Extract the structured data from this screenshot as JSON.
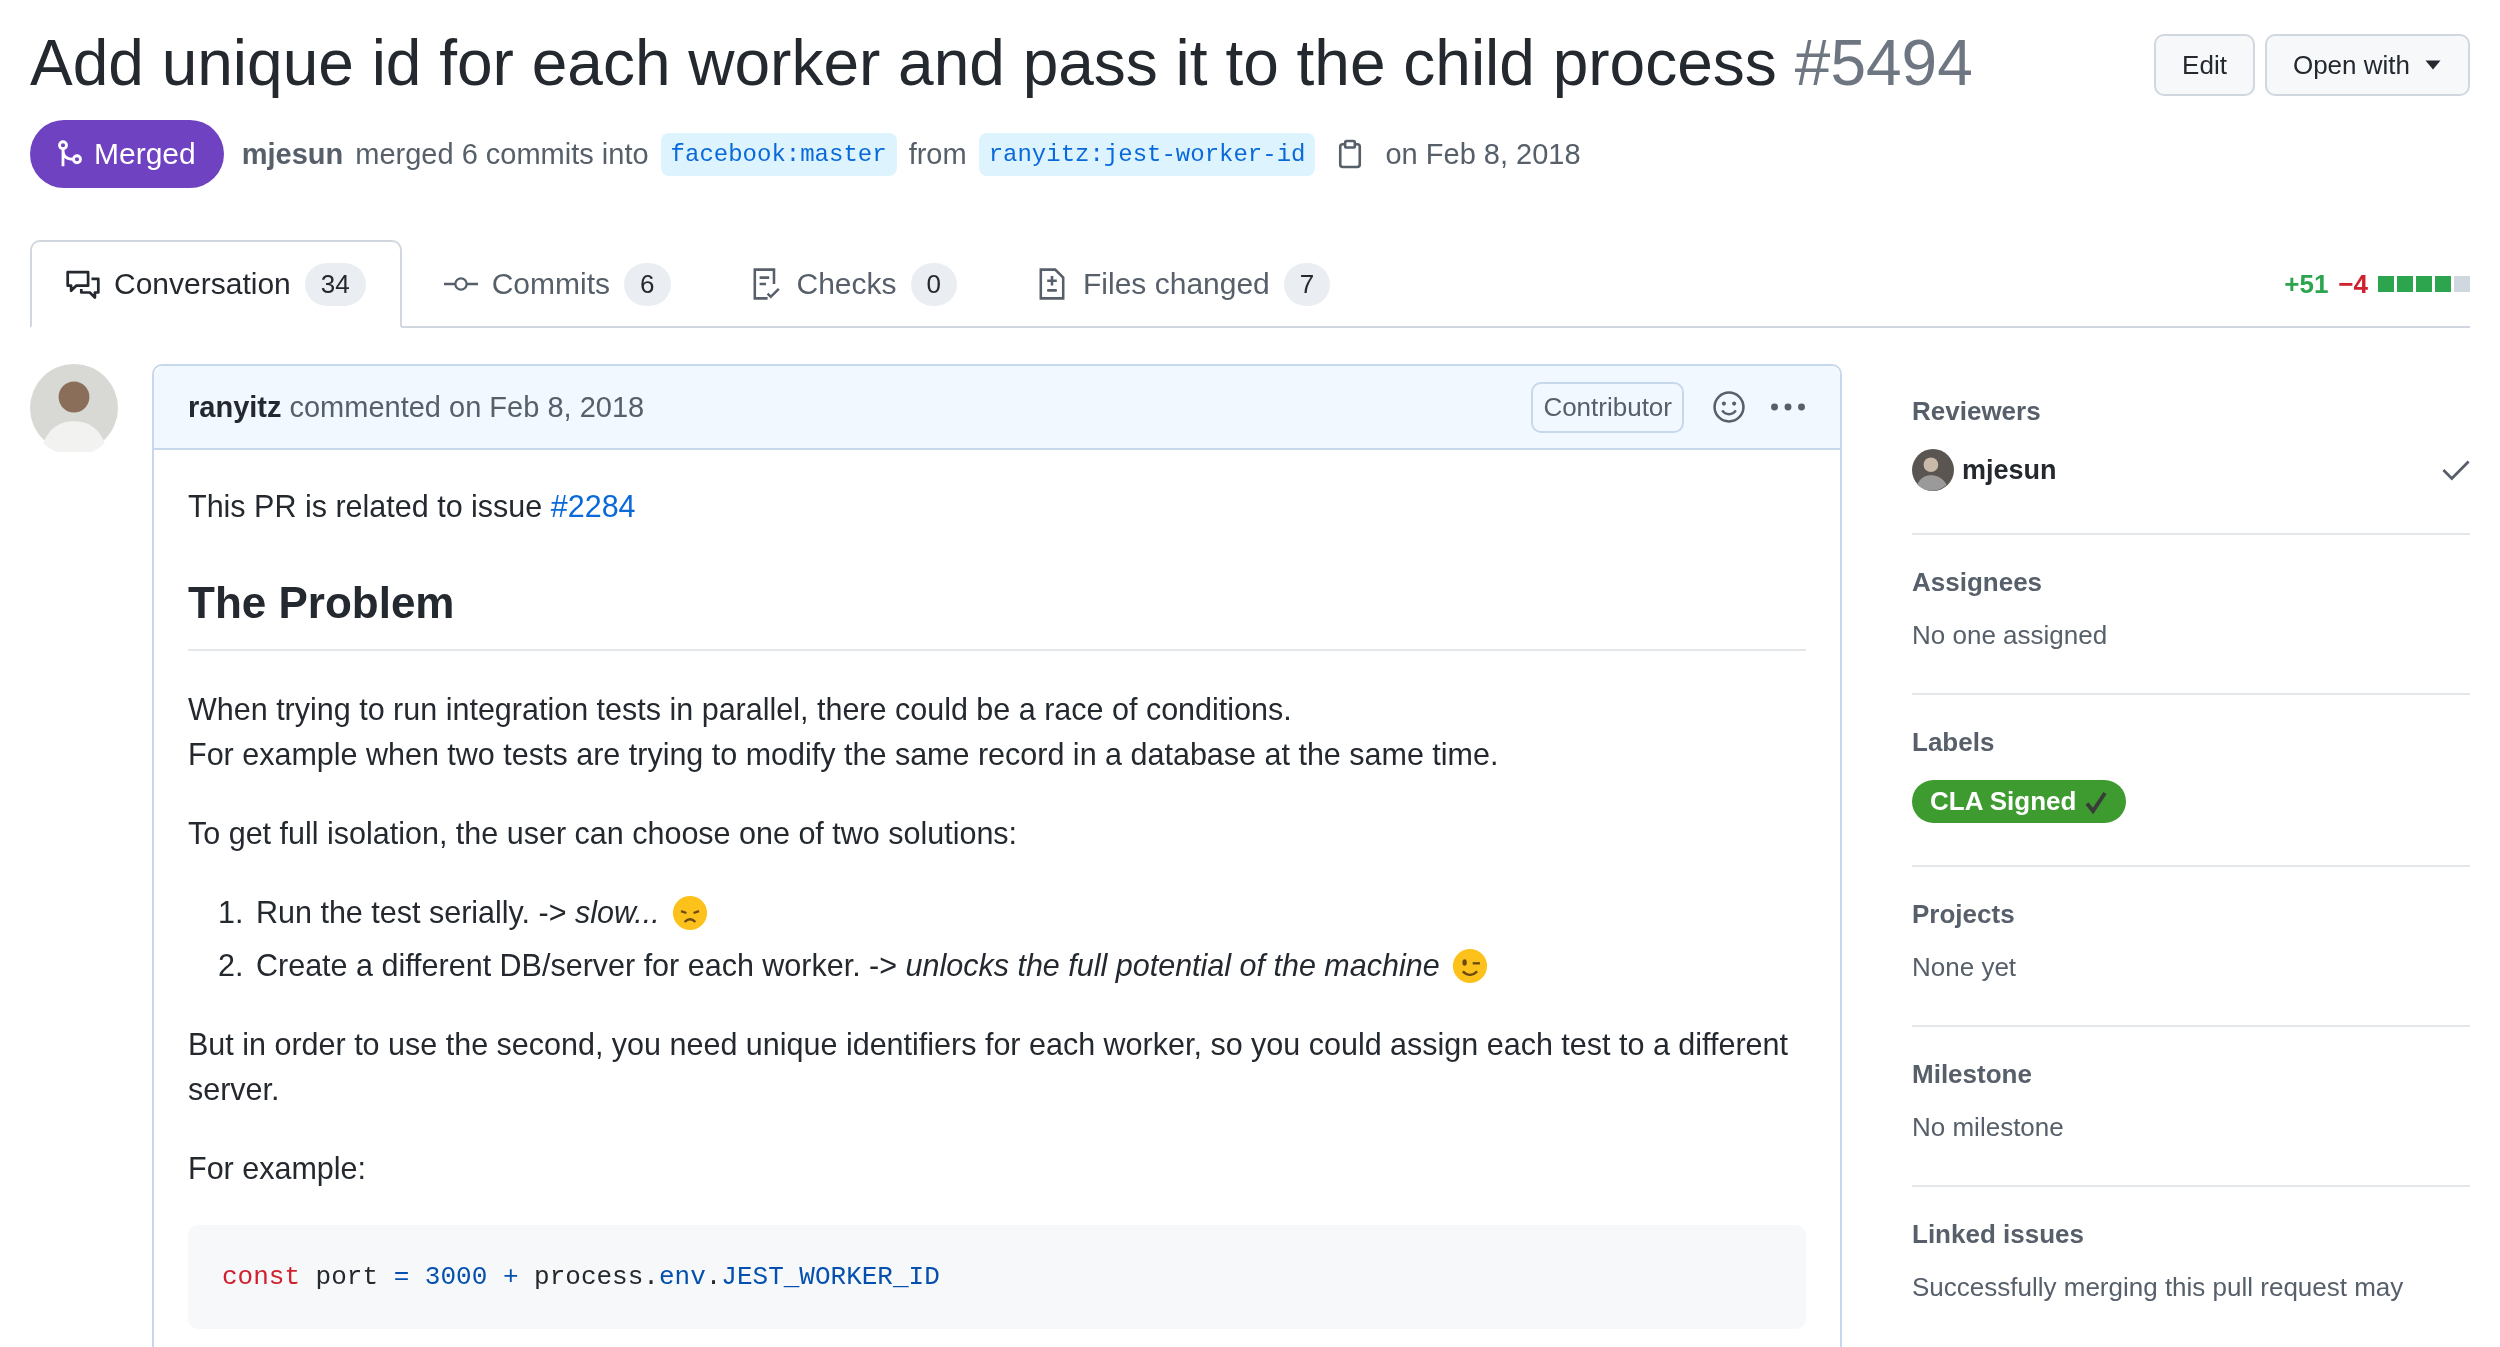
{
  "title": "Add unique id for each worker and pass it to the child process",
  "number": "#5494",
  "header_buttons": [
    {
      "label": "Edit",
      "dropdown": false
    },
    {
      "label": "Open with",
      "dropdown": true
    }
  ],
  "state": {
    "label": "Merged",
    "author": "mjesun",
    "action": "merged 6 commits into",
    "base": "facebook:master",
    "from_word": "from",
    "head": "ranyitz:jest-worker-id",
    "date": "on Feb 8, 2018"
  },
  "tabs": [
    {
      "label": "Conversation",
      "count": "34",
      "selected": true
    },
    {
      "label": "Commits",
      "count": "6",
      "selected": false
    },
    {
      "label": "Checks",
      "count": "0",
      "selected": false
    },
    {
      "label": "Files changed",
      "count": "7",
      "selected": false
    }
  ],
  "diffstat": {
    "added": "+51",
    "removed": "−4",
    "blocks": [
      {
        "filled": true
      },
      {
        "filled": true
      },
      {
        "filled": true
      },
      {
        "filled": true
      },
      {
        "filled": false
      }
    ]
  },
  "comment": {
    "author": "ranyitz",
    "meta": "commented on Feb 8, 2018",
    "role": "Contributor",
    "body": [
      {
        "kind": "paragraph",
        "text": "This PR is related to issue ",
        "link": "#2284"
      },
      {
        "kind": "heading",
        "text": "The Problem"
      },
      {
        "kind": "paragraph",
        "lines": [
          "When trying to run integration tests in parallel, there could be a race of conditions.",
          "For example when two tests are trying to modify the same record in a database at the same time."
        ]
      },
      {
        "kind": "paragraph",
        "text": "To get full isolation, the user can choose one of two solutions:"
      },
      {
        "kind": "list",
        "items": [
          {
            "number": "1.",
            "text": "Run the test serially. -> *slow...*",
            "kind": "sad"
          },
          {
            "number": "2.",
            "text": "Create a different DB/server for each worker. -> *unlocks the full potential of the machine*",
            "kind": "wink"
          }
        ]
      },
      {
        "kind": "paragraph",
        "text": "But in order to use the second, you need unique identifiers for each worker, so you could assign each test to a different server."
      },
      {
        "kind": "paragraph",
        "text": "For example:"
      },
      {
        "kind": "code",
        "tokens": [
          {
            "kind": "keyword",
            "text": "const"
          },
          {
            "kind": "plain",
            "text": " port "
          },
          {
            "kind": "operator",
            "text": "= "
          },
          {
            "kind": "number",
            "text": "3000"
          },
          {
            "kind": "operator",
            "text": " + "
          },
          {
            "kind": "plain",
            "text": "process."
          },
          {
            "kind": "property",
            "text": "env"
          },
          {
            "kind": "plain",
            "text": "."
          },
          {
            "kind": "property",
            "text": "JEST_WORKER_ID"
          }
        ]
      }
    ]
  },
  "sidebar": [
    {
      "kind": "reviewers",
      "heading": "Reviewers",
      "name": "mjesun",
      "approved": true
    },
    {
      "kind": "text",
      "heading": "Assignees",
      "text": "No one assigned"
    },
    {
      "kind": "label",
      "heading": "Labels",
      "label": "CLA Signed",
      "color": "#3e9b2f"
    },
    {
      "kind": "text",
      "heading": "Projects",
      "text": "None yet"
    },
    {
      "kind": "text",
      "heading": "Milestone",
      "text": "No milestone"
    },
    {
      "kind": "text",
      "heading": "Linked issues",
      "text": "Successfully merging this pull request may"
    }
  ]
}
